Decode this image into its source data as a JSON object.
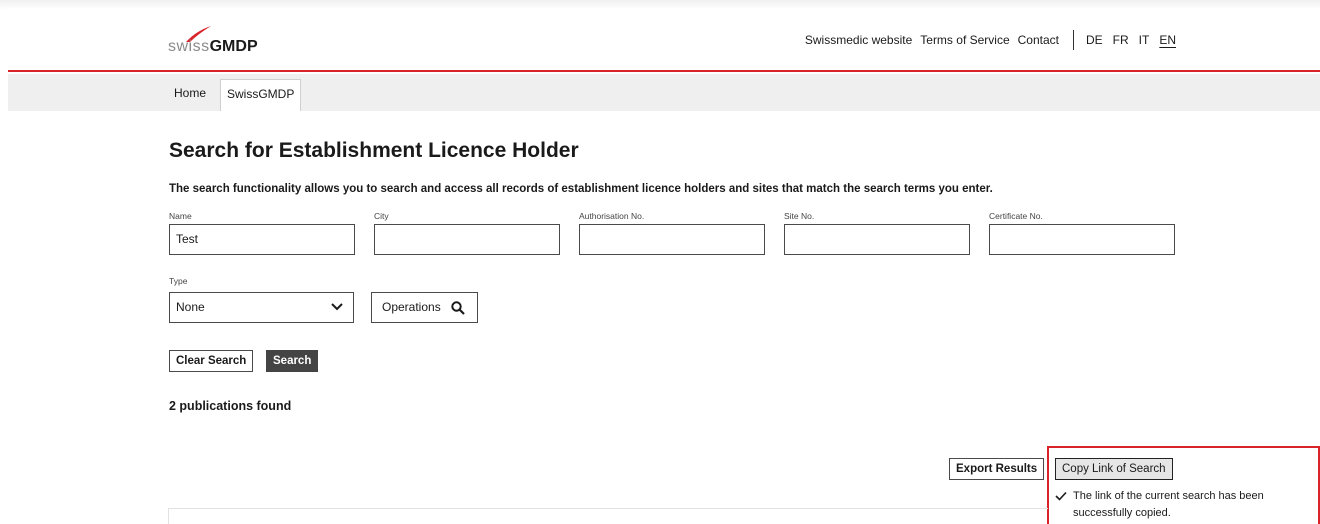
{
  "header": {
    "logo_swiss": "swiss",
    "logo_gmdp": "GMDP",
    "links": [
      "Swissmedic website",
      "Terms of Service",
      "Contact"
    ],
    "languages": [
      "DE",
      "FR",
      "IT",
      "EN"
    ],
    "active_language": "EN",
    "accent_color": "#d8232a"
  },
  "breadcrumb": {
    "home": "Home",
    "current": "SwissGMDP"
  },
  "main": {
    "title": "Search for Establishment Licence Holder",
    "description": "The search functionality allows you to search and access all records of establishment licence holders and sites that match the search terms you enter.",
    "fields": {
      "name": {
        "label": "Name",
        "value": "Test"
      },
      "city": {
        "label": "City",
        "value": ""
      },
      "authorisation": {
        "label": "Authorisation No.",
        "value": ""
      },
      "site": {
        "label": "Site No.",
        "value": ""
      },
      "certificate": {
        "label": "Certificate No.",
        "value": ""
      }
    },
    "type": {
      "label": "Type",
      "selected": "None"
    },
    "operations_button": "Operations",
    "clear_button": "Clear Search",
    "search_button": "Search",
    "results_count": "2 publications found",
    "export_button": "Export Results",
    "copy_link_button": "Copy Link of Search",
    "copied_message": "The link of the current search has been successfully copied."
  },
  "icons": {
    "select": "chevron-down-icon",
    "operations": "search-icon",
    "copied": "checkmark-icon"
  }
}
